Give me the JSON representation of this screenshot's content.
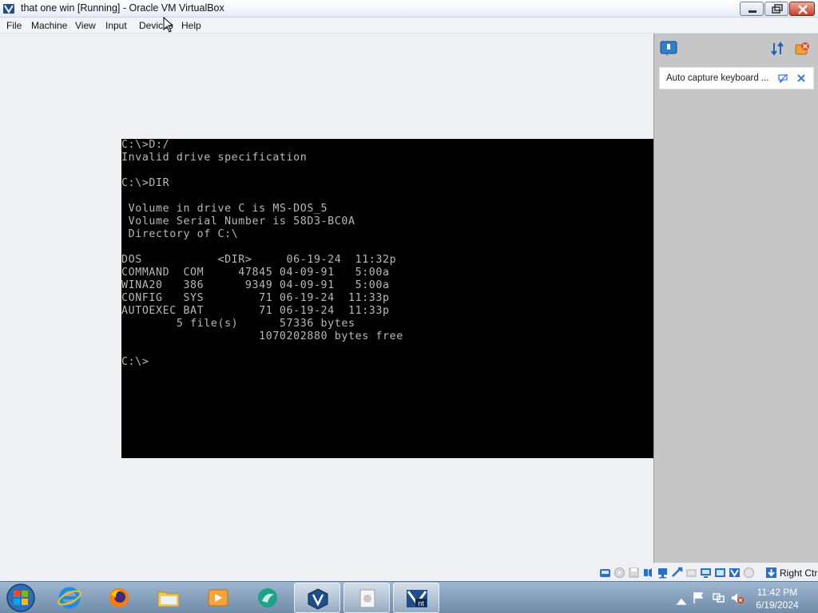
{
  "window": {
    "title": "that one win [Running] - Oracle VM VirtualBox"
  },
  "menu": {
    "items": [
      "File",
      "Machine",
      "View",
      "Input",
      "Devices",
      "Help"
    ]
  },
  "vm_screen": {
    "lines": [
      "C:\\>D:/",
      "Invalid drive specification",
      "",
      "C:\\>DIR",
      "",
      " Volume in drive C is MS-DOS_5",
      " Volume Serial Number is 58D3-BC0A",
      " Directory of C:\\",
      "",
      "DOS           <DIR>     06-19-24  11:32p",
      "COMMAND  COM     47845 04-09-91   5:00a",
      "WINA20   386      9349 04-09-91   5:00a",
      "CONFIG   SYS        71 06-19-24  11:33p",
      "AUTOEXEC BAT        71 06-19-24  11:33p",
      "        5 file(s)      57336 bytes",
      "                    1070202880 bytes free",
      "",
      "C:\\>"
    ]
  },
  "notifications": {
    "message": "Auto capture keyboard ..."
  },
  "statusbar": {
    "host_key": "Right Ctrl"
  },
  "taskbar": {
    "clock_time": "11:42 PM",
    "clock_date": "6/19/2024"
  },
  "colors": {
    "dos_text": "#b8b8b8",
    "dos_bg": "#000000",
    "panel_bg": "#c6c6c6",
    "taskbar": "#7f9bb8"
  }
}
